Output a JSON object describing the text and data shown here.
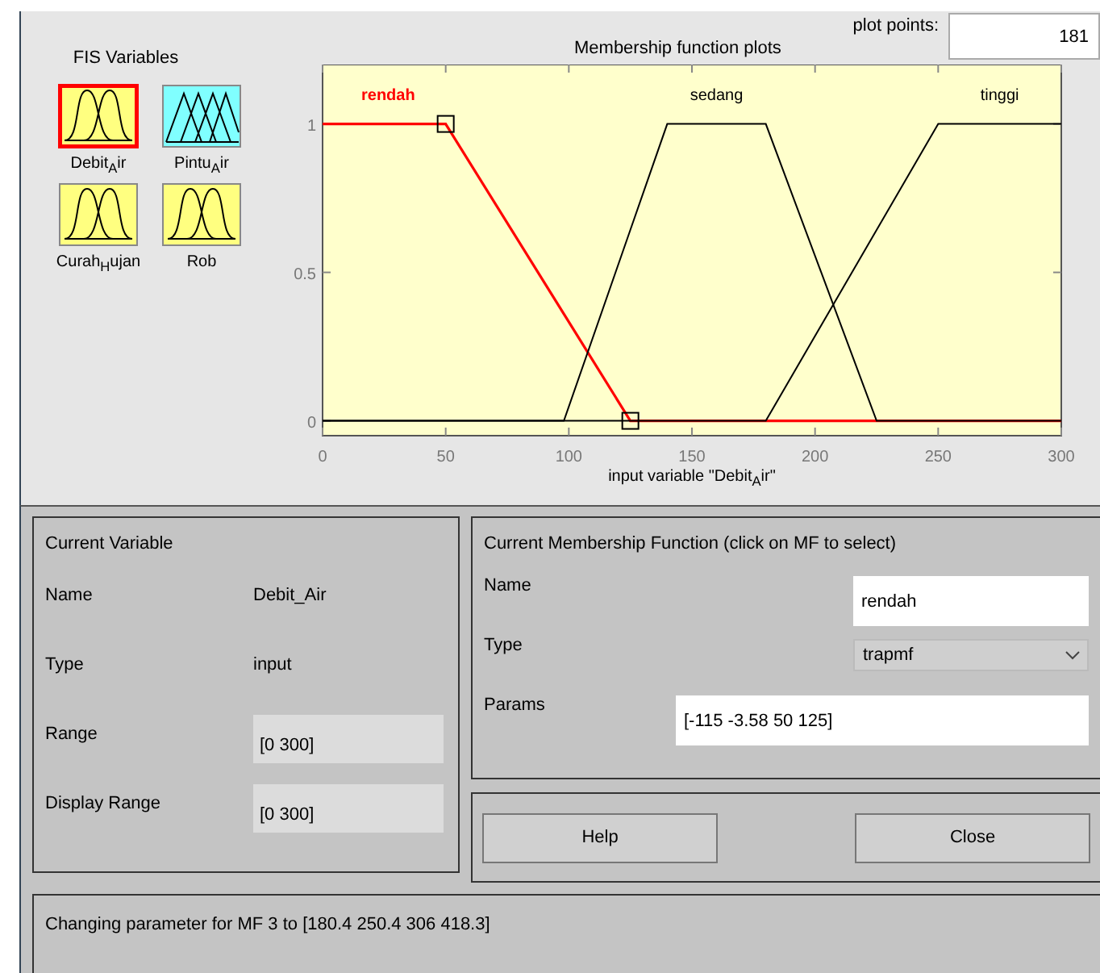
{
  "variables_panel": {
    "title": "FIS Variables",
    "variables": [
      {
        "name": "Debit$_{A}$ir",
        "kind": "input",
        "selected": true
      },
      {
        "name": "Pintu$_{A}$ir",
        "kind": "output",
        "selected": false
      },
      {
        "name": "Curah$_{H}$ujan",
        "kind": "input",
        "selected": false
      },
      {
        "name": "Rob",
        "kind": "input",
        "selected": false
      }
    ]
  },
  "plot": {
    "plot_points_label": "plot points:",
    "plot_points": "181",
    "curve_states": [
      {
        "selected": true
      },
      {
        "selected": false
      },
      {
        "selected": false
      }
    ],
    "chart_data": {
      "type": "line",
      "title": "Membership function plots",
      "xlabel": "input variable \"Debit$_{A}$ir\"",
      "x": [
        0,
        50,
        98,
        125,
        140,
        180,
        225,
        250,
        300
      ],
      "series": [
        {
          "name": "rendah",
          "color": "#ff0000",
          "values": [
            1,
            1,
            0.36,
            0,
            0,
            0,
            0,
            0,
            0
          ]
        },
        {
          "name": "sedang",
          "color": "#000000",
          "values": [
            0,
            0,
            0,
            0.643,
            1,
            1,
            0,
            0,
            0
          ]
        },
        {
          "name": "tinggi",
          "color": "#000000",
          "values": [
            0,
            0,
            0,
            0,
            0,
            0,
            0.643,
            1,
            1
          ]
        }
      ],
      "xlim": [
        0,
        300
      ],
      "ylim": [
        -0.05,
        1.2
      ],
      "xticks": [
        0,
        50,
        100,
        150,
        200,
        250,
        300
      ],
      "yticks": [
        0,
        0.5,
        1
      ]
    }
  },
  "current_variable": {
    "title": "Current Variable",
    "rows": [
      {
        "label": "Name",
        "value": "Debit_Air",
        "kind": "text"
      },
      {
        "label": "Type",
        "value": "input",
        "kind": "text"
      },
      {
        "label": "Range",
        "value": "[0 300]",
        "kind": "field"
      },
      {
        "label": "Display Range",
        "value": "[0 300]",
        "kind": "field"
      }
    ]
  },
  "current_mf": {
    "title": "Current Membership Function (click on MF to select)",
    "name_label": "Name",
    "name": "rendah",
    "type_label": "Type",
    "type": "trapmf",
    "params_label": "Params",
    "params": "[-115 -3.58 50 125]"
  },
  "buttons": [
    "Help",
    "Close"
  ],
  "status_bar": "Changing parameter for MF 3 to  [180.4 250.4 306 418.3]"
}
